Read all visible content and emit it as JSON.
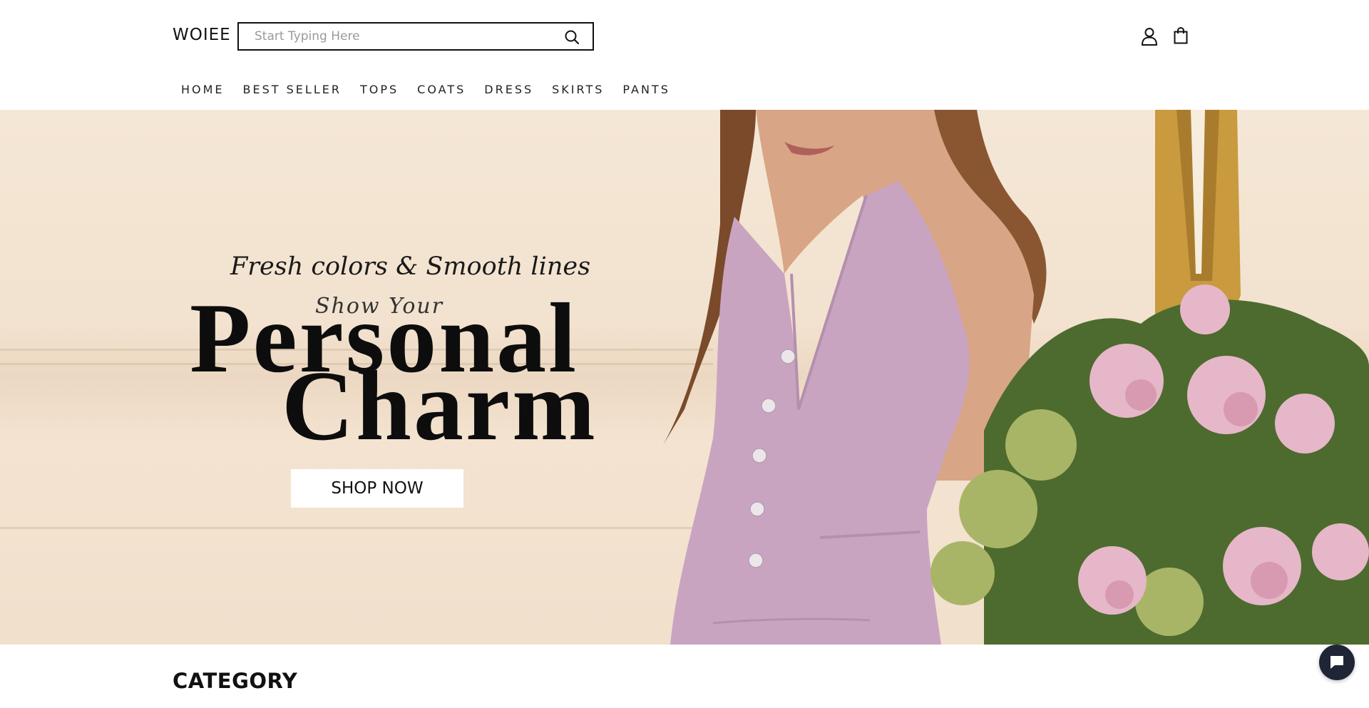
{
  "header": {
    "logo": "WOIEE",
    "search_placeholder": "Start Typing Here"
  },
  "icons": {
    "search": "search-icon",
    "account": "user-icon",
    "cart": "shopping-bag-icon",
    "chat": "chat-icon"
  },
  "nav": {
    "items": [
      "HOME",
      "BEST SELLER",
      "TOPS",
      "COATS",
      "DRESS",
      "SKIRTS",
      "PANTS"
    ]
  },
  "hero": {
    "tagline": "Fresh colors & Smooth lines",
    "script_text": "Show Your",
    "headline_1": "Personal",
    "headline_2": "Charm",
    "cta": "SHOP NOW"
  },
  "sections": {
    "category_title": "CATEGORY"
  },
  "colors": {
    "hero_bg": "#f2e2cf",
    "vest": "#c9a4c1",
    "chat_bg": "#1f2535"
  }
}
